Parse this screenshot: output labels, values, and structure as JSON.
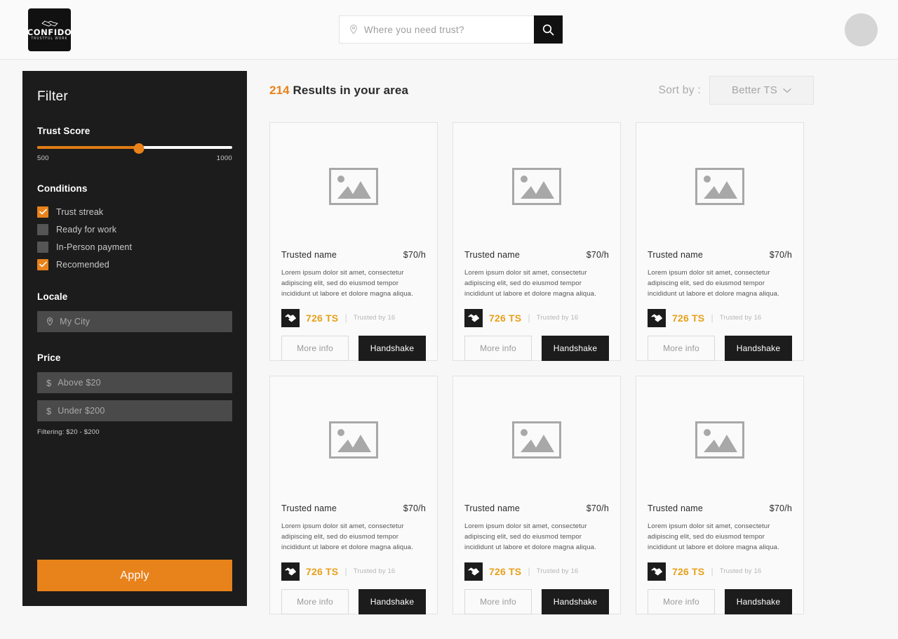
{
  "header": {
    "logo": {
      "name": "CONFIDO",
      "tagline": "TRUSTFUL WORK",
      "icon": "handshake-icon"
    },
    "search": {
      "placeholder": "Where you need trust?",
      "value": "",
      "icon": "location-pin-icon",
      "button_icon": "search-icon"
    },
    "avatar": {
      "icon": "user-avatar"
    }
  },
  "sidebar": {
    "title": "Filter",
    "trust_score": {
      "label": "Trust Score",
      "min_label": "500",
      "max_label": "1000",
      "thumb_percent": 52
    },
    "conditions": {
      "label": "Conditions",
      "items": [
        {
          "label": "Trust streak",
          "checked": true
        },
        {
          "label": "Ready for work",
          "checked": false
        },
        {
          "label": "In-Person payment",
          "checked": false
        },
        {
          "label": "Recomended",
          "checked": true
        }
      ]
    },
    "locale": {
      "label": "Locale",
      "placeholder": "My City",
      "value": "",
      "icon": "location-pin-icon"
    },
    "price": {
      "label": "Price",
      "min": {
        "placeholder": "Above $20",
        "value": "",
        "icon": "dollar-icon"
      },
      "max": {
        "placeholder": "Under $200",
        "value": "",
        "icon": "dollar-icon"
      },
      "note": "Filtering: $20 - $200"
    },
    "apply_label": "Apply"
  },
  "main": {
    "results": {
      "count": "214",
      "text": " Results in your area"
    },
    "sort": {
      "label": "Sort by :",
      "value": "Better TS",
      "chevron": "chevron-down-icon"
    },
    "card": {
      "name": "Trusted name",
      "price": "$70/h",
      "description": "Lorem ipsum dolor sit amet, consectetur adipiscing elit, sed do eiusmod tempor incididunt ut labore et dolore magna aliqua.",
      "trust_score": "726 TS",
      "trusted_by": "Trusted by 16",
      "divider": "|",
      "more_info_label": "More info",
      "handshake_label": "Handshake",
      "thumb_icon": "image-placeholder-icon",
      "badge_icon": "handshake-badge-icon"
    },
    "cards_visible": 6
  },
  "colors": {
    "accent": "#e8821a",
    "score": "#e8a01a",
    "dark": "#1c1c1c",
    "page_bg": "#f7f7f7"
  }
}
